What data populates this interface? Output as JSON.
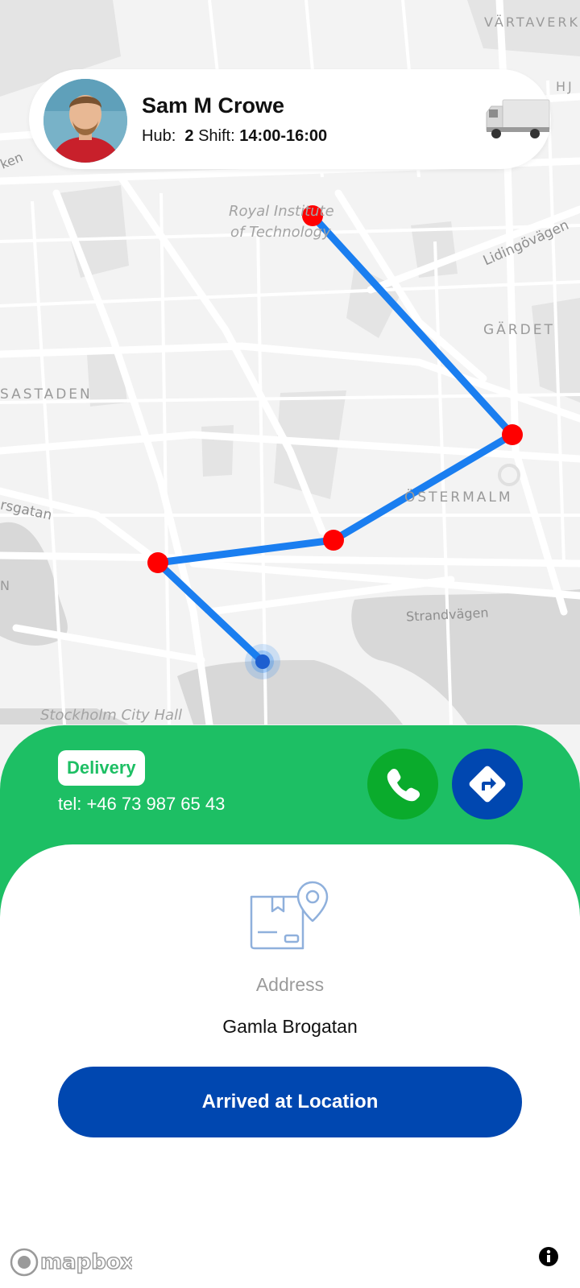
{
  "driver": {
    "name": "Sam M Crowe",
    "hub_label": "Hub:",
    "hub_value": "2",
    "shift_label": "Shift:",
    "shift_value": "14:00-16:00"
  },
  "map": {
    "labels": {
      "vartaverket": "VÄRTAVERKE",
      "hj": "HJ",
      "ken": "ken",
      "royal_1": "Royal Institute",
      "royal_2": "of Technology",
      "lidingovagen": "Lidingövägen",
      "gardet": "GÄRDET",
      "vasastaden": "SASTADEN",
      "ostermalm": "ÖSTERMALM",
      "rsgatan": "rsgatan",
      "strandvagen": "Strandvägen",
      "city_hall": "Stockholm City Hall",
      "n": "N"
    },
    "route_color": "#1a7ef0",
    "stop_color": "#ff0000"
  },
  "delivery": {
    "tag": "Delivery",
    "phone": "tel: +46 73 987 65 43"
  },
  "address": {
    "label": "Address",
    "value": "Gamla Brogatan"
  },
  "actions": {
    "arrived": "Arrived at Location"
  },
  "attribution": {
    "logo_text": "mapbox"
  },
  "colors": {
    "green": "#1dbf64",
    "call_green": "#0aab2c",
    "blue": "#0047b0"
  },
  "icons": [
    "truck-icon",
    "phone-icon",
    "directions-icon",
    "package-location-icon",
    "mapbox-logo",
    "info-icon"
  ]
}
